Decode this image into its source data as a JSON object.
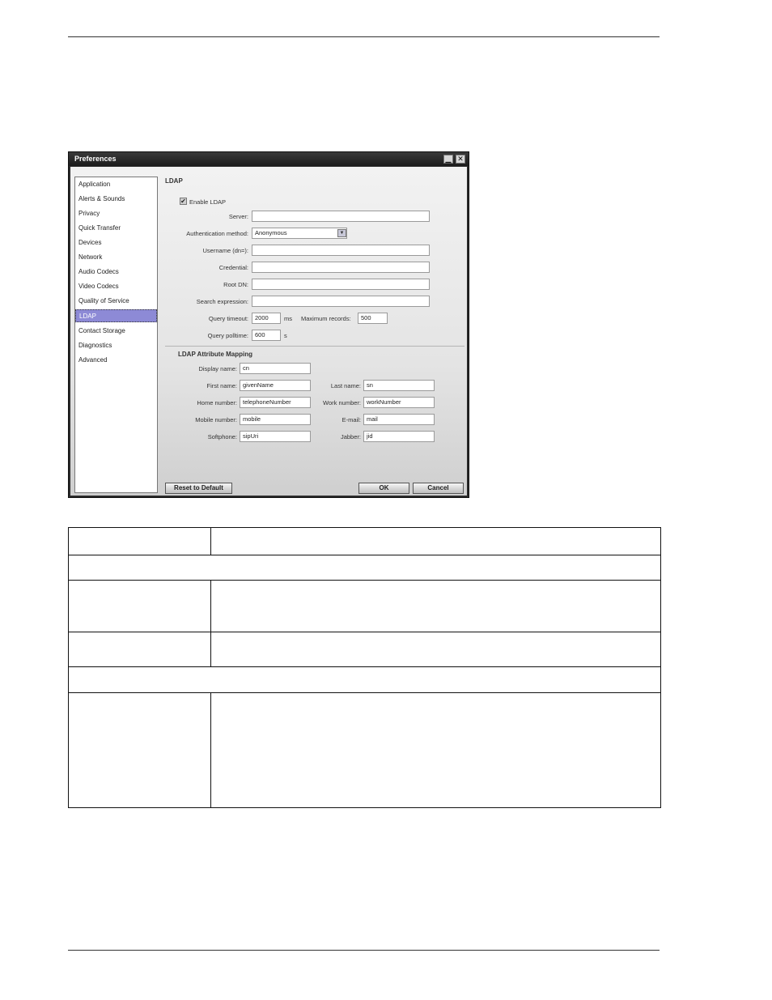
{
  "window": {
    "title": "Preferences",
    "minimize_glyph": "▁",
    "close_glyph": "✕"
  },
  "sidebar": {
    "items": [
      {
        "label": "Application"
      },
      {
        "label": "Alerts & Sounds"
      },
      {
        "label": "Privacy"
      },
      {
        "label": "Quick Transfer"
      },
      {
        "label": "Devices"
      },
      {
        "label": "Network"
      },
      {
        "label": "Audio Codecs"
      },
      {
        "label": "Video Codecs"
      },
      {
        "label": "Quality of Service"
      },
      {
        "label": "LDAP"
      },
      {
        "label": "Contact Storage"
      },
      {
        "label": "Diagnostics"
      },
      {
        "label": "Advanced"
      }
    ],
    "selected": "LDAP"
  },
  "ldap": {
    "section_title": "LDAP",
    "enable": {
      "label": "Enable LDAP",
      "checked": true
    },
    "server": {
      "label": "Server:",
      "value": ""
    },
    "auth_method": {
      "label": "Authentication method:",
      "value": "Anonymous"
    },
    "username": {
      "label": "Username (dn=):",
      "value": ""
    },
    "credential": {
      "label": "Credential:",
      "value": ""
    },
    "root_dn": {
      "label": "Root DN:",
      "value": ""
    },
    "search_expression": {
      "label": "Search expression:",
      "value": ""
    },
    "query_timeout": {
      "label": "Query timeout:",
      "value": "2000",
      "unit": "ms"
    },
    "max_records": {
      "label": "Maximum records:",
      "value": "500"
    },
    "query_polltime": {
      "label": "Query polltime:",
      "value": "600",
      "unit": "s"
    }
  },
  "mapping": {
    "title": "LDAP Attribute Mapping",
    "display_name": {
      "label": "Display name:",
      "value": "cn"
    },
    "first_name": {
      "label": "First name:",
      "value": "givenName"
    },
    "last_name": {
      "label": "Last name:",
      "value": "sn"
    },
    "home_number": {
      "label": "Home number:",
      "value": "telephoneNumber"
    },
    "work_number": {
      "label": "Work number:",
      "value": "workNumber"
    },
    "mobile_number": {
      "label": "Mobile number:",
      "value": "mobile"
    },
    "email": {
      "label": "E-mail:",
      "value": "mail"
    },
    "softphone": {
      "label": "Softphone:",
      "value": "sipUri"
    },
    "jabber": {
      "label": "Jabber:",
      "value": "jid"
    }
  },
  "buttons": {
    "reset": "Reset to Default",
    "ok": "OK",
    "cancel": "Cancel"
  },
  "icons": {
    "dropdown": "chevron-down-icon",
    "checkbox": "checkmark-icon"
  }
}
